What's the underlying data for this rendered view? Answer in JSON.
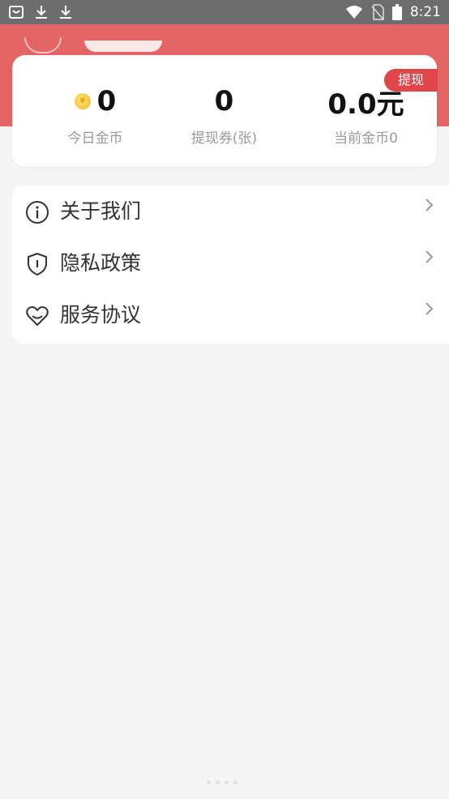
{
  "status_bar": {
    "time": "8:21",
    "left_icons": [
      "shopping-bag-notification-icon",
      "download-icon",
      "download-icon"
    ],
    "right_icons": [
      "wifi-icon",
      "no-sim-icon",
      "battery-icon"
    ]
  },
  "colors": {
    "banner": "#e46565",
    "accent": "#e0454a",
    "coin": "#f2b81c"
  },
  "stats": {
    "withdraw_label": "提现",
    "today_coins": {
      "value": "0",
      "label": "今日金币"
    },
    "vouchers": {
      "value": "0",
      "label": "提现券(张)"
    },
    "current": {
      "value": "0.0元",
      "label": "当前金币0"
    }
  },
  "menu": {
    "items": [
      {
        "label": "关于我们",
        "icon": "info-icon"
      },
      {
        "label": "隐私政策",
        "icon": "shield-icon"
      },
      {
        "label": "服务协议",
        "icon": "heart-smile-icon"
      }
    ]
  }
}
